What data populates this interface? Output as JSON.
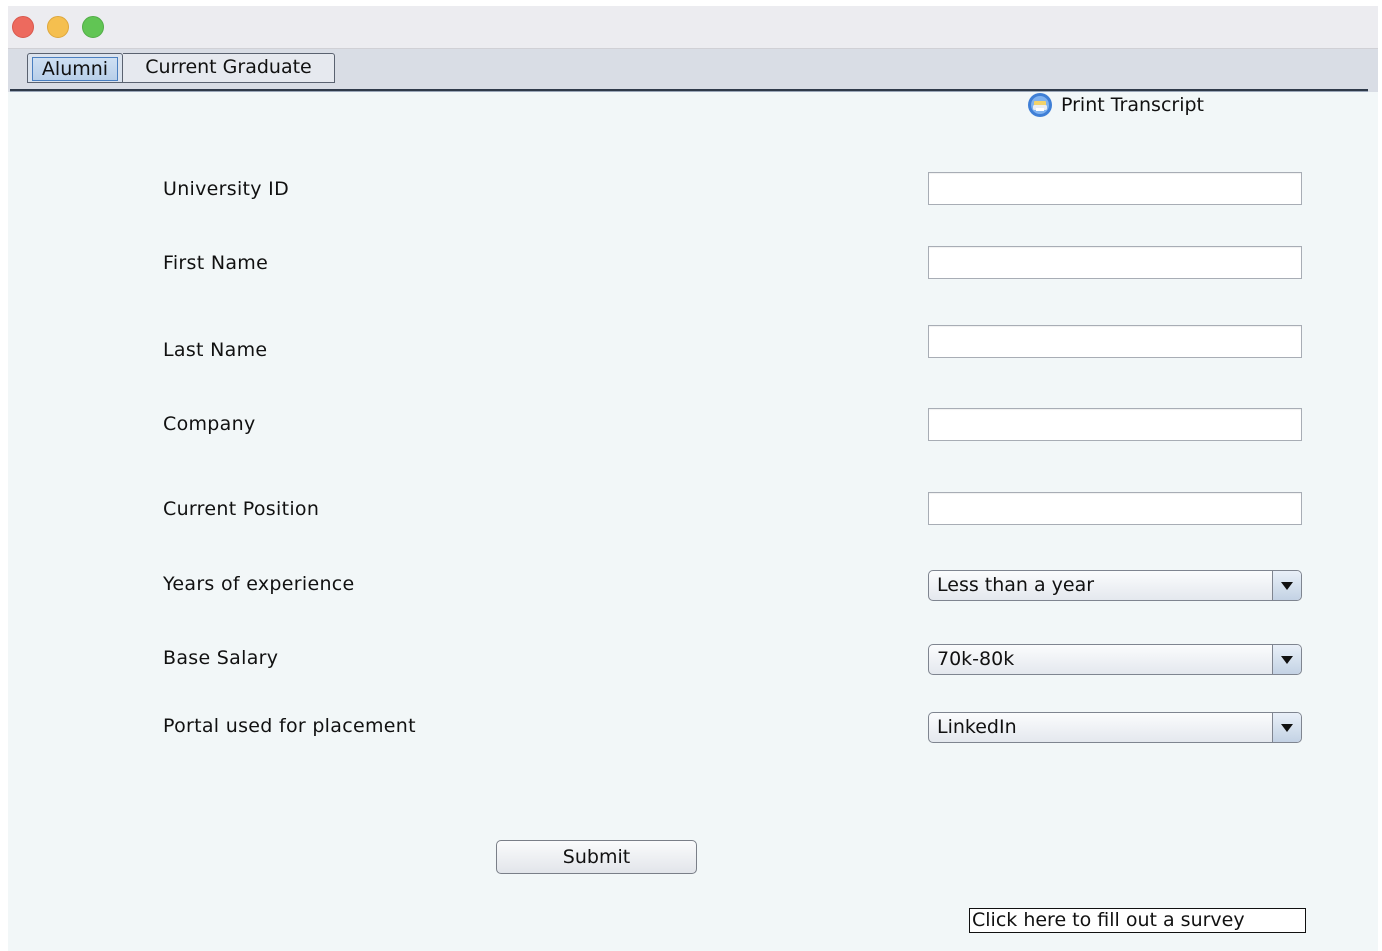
{
  "tabs": [
    {
      "label": "Alumni",
      "selected": true
    },
    {
      "label": "Current Graduate",
      "selected": false
    }
  ],
  "toolbar": {
    "print_label": "Print Transcript",
    "print_icon": "printer-icon"
  },
  "form": {
    "university_id": {
      "label": "University ID",
      "value": ""
    },
    "first_name": {
      "label": "First Name",
      "value": ""
    },
    "last_name": {
      "label": "Last Name",
      "value": ""
    },
    "company": {
      "label": "Company",
      "value": ""
    },
    "current_position": {
      "label": "Current Position",
      "value": ""
    },
    "years_experience": {
      "label": "Years of experience",
      "selected": "Less than a year"
    },
    "base_salary": {
      "label": "Base Salary",
      "selected": "70k-80k"
    },
    "portal": {
      "label": "Portal used for placement",
      "selected": "LinkedIn"
    }
  },
  "actions": {
    "submit_label": "Submit",
    "survey_label": "Click here to fill out a survey"
  },
  "colors": {
    "background": "#f2f7f8",
    "selected_tab": "#cfe0f3",
    "window_close": "#ed6a5e",
    "window_minimize": "#f5bf4f",
    "window_maximize": "#61c554"
  }
}
